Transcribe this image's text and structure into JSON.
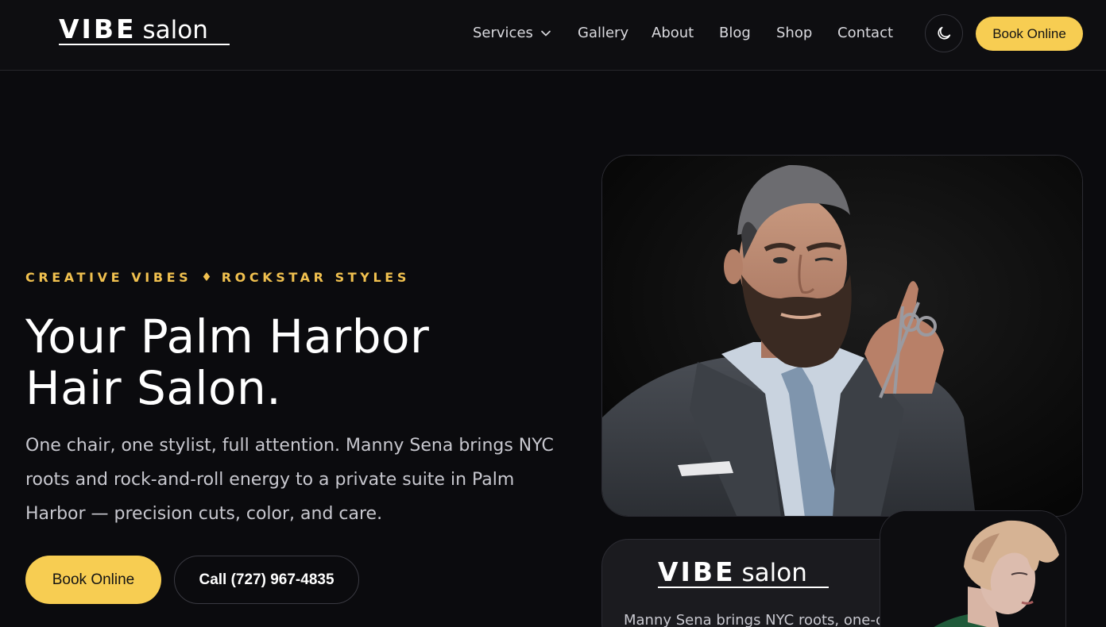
{
  "brand": {
    "logo_vibe": "VIBE",
    "logo_salon": "salon"
  },
  "nav": {
    "items": [
      {
        "label": "Services"
      },
      {
        "label": "Gallery"
      },
      {
        "label": "About"
      },
      {
        "label": "Blog"
      },
      {
        "label": "Shop"
      },
      {
        "label": "Contact"
      }
    ],
    "book_label": "Book Online"
  },
  "hero": {
    "eyebrow_left": "CREATIVE VIBES",
    "eyebrow_separator": "♦",
    "eyebrow_right": "ROCKSTAR STYLES",
    "title_line1": "Your Palm Harbor",
    "title_line2": "Hair Salon.",
    "description": "One chair, one stylist, full attention. Manny Sena brings NYC roots and rock-and-roll energy to a private suite in Palm Harbor — precision cuts, color, and care.",
    "book_label": "Book Online",
    "call_label": "Call (727) 967-4835"
  },
  "card": {
    "logo_vibe": "VIBE",
    "logo_salon": "salon",
    "text": "Manny Sena brings NYC roots, one-on"
  },
  "icons": {
    "services_dropdown": "chevron-down-icon",
    "theme_toggle": "moon-icon"
  },
  "colors": {
    "accent": "#f7cd52",
    "eyebrow": "#f1c14f",
    "background": "#0b0b0e"
  }
}
